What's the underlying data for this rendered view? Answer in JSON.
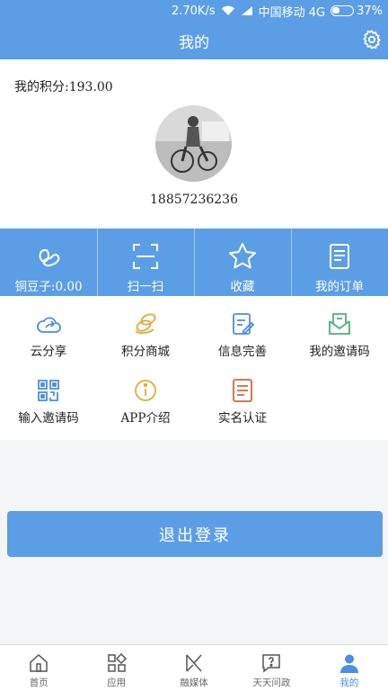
{
  "status_bar": {
    "speed": "2.70K/s",
    "carrier": "中国移动 4G",
    "battery": "37%"
  },
  "header": {
    "title": "我的",
    "settings_icon": "gear-icon"
  },
  "profile": {
    "points_label": "我的积分:193.00",
    "phone": "18857236236"
  },
  "quick_actions": [
    {
      "label": "铜豆子:0.00",
      "icon": "beans-icon"
    },
    {
      "label": "扫一扫",
      "icon": "scan-icon"
    },
    {
      "label": "收藏",
      "icon": "star-icon"
    },
    {
      "label": "我的订单",
      "icon": "order-icon"
    }
  ],
  "grid": [
    {
      "label": "云分享",
      "icon": "cloud-share-icon",
      "color": "#4a8fd9"
    },
    {
      "label": "积分商城",
      "icon": "coins-icon",
      "color": "#e0a93a"
    },
    {
      "label": "信息完善",
      "icon": "edit-doc-icon",
      "color": "#4a8fd9"
    },
    {
      "label": "我的邀请码",
      "icon": "mail-icon",
      "color": "#4caf7a"
    },
    {
      "label": "输入邀请码",
      "icon": "qr-code-icon",
      "color": "#4a8fd9"
    },
    {
      "label": "APP介绍",
      "icon": "info-icon",
      "color": "#e0a93a"
    },
    {
      "label": "实名认证",
      "icon": "id-doc-icon",
      "color": "#c86a3d"
    }
  ],
  "logout_label": "退出登录",
  "tabs": [
    {
      "label": "首页",
      "icon": "home-icon",
      "active": false
    },
    {
      "label": "应用",
      "icon": "apps-icon",
      "active": false
    },
    {
      "label": "融媒体",
      "icon": "media-icon",
      "active": false
    },
    {
      "label": "天天问政",
      "icon": "question-icon",
      "active": false
    },
    {
      "label": "我的",
      "icon": "user-icon",
      "active": true
    }
  ],
  "colors": {
    "primary": "#5c9ee6",
    "active_tab": "#4a90e2"
  }
}
